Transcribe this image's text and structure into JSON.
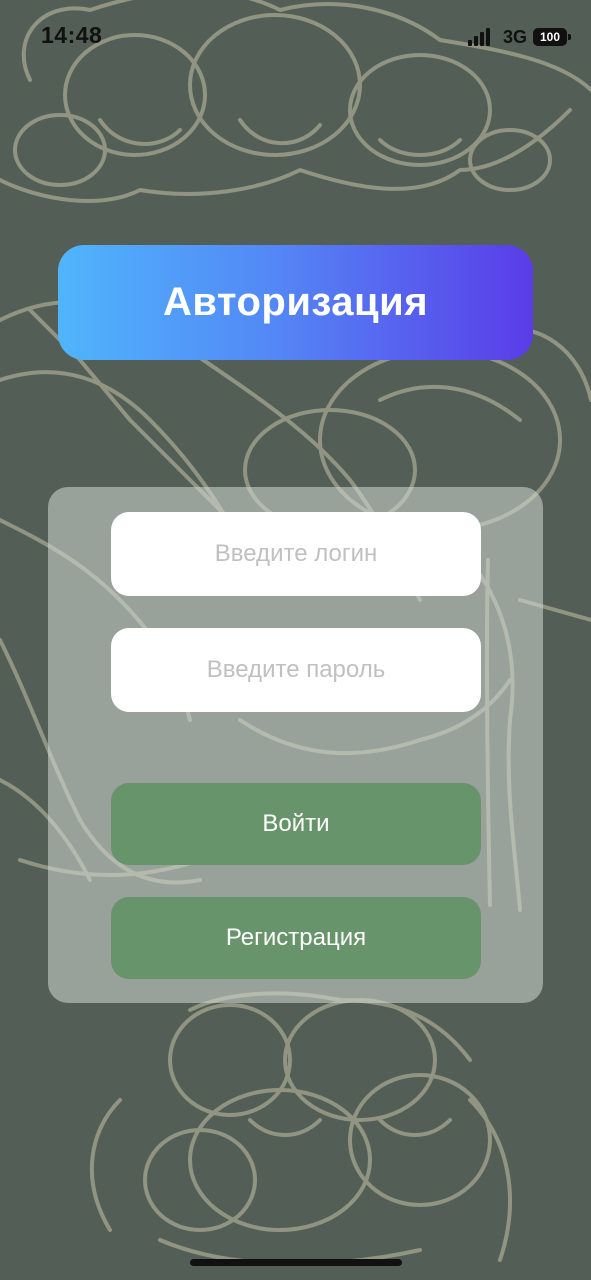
{
  "status_bar": {
    "time": "14:48",
    "network": "3G",
    "battery": "100",
    "signal_icon": "cellular-signal-icon",
    "battery_icon": "battery-icon"
  },
  "title": "Авторизация",
  "form": {
    "login_placeholder": "Введите логин",
    "login_value": "",
    "password_placeholder": "Введите пароль",
    "password_value": "",
    "enter_label": "Войти",
    "register_label": "Регистрация"
  },
  "colors": {
    "background": "#535f56",
    "gradient_start": "#4fb5fb",
    "gradient_end": "#5a3ce8",
    "button": "#67946a",
    "panel": "#d2d8d4"
  },
  "background_art": "cloudberry-line-illustration"
}
